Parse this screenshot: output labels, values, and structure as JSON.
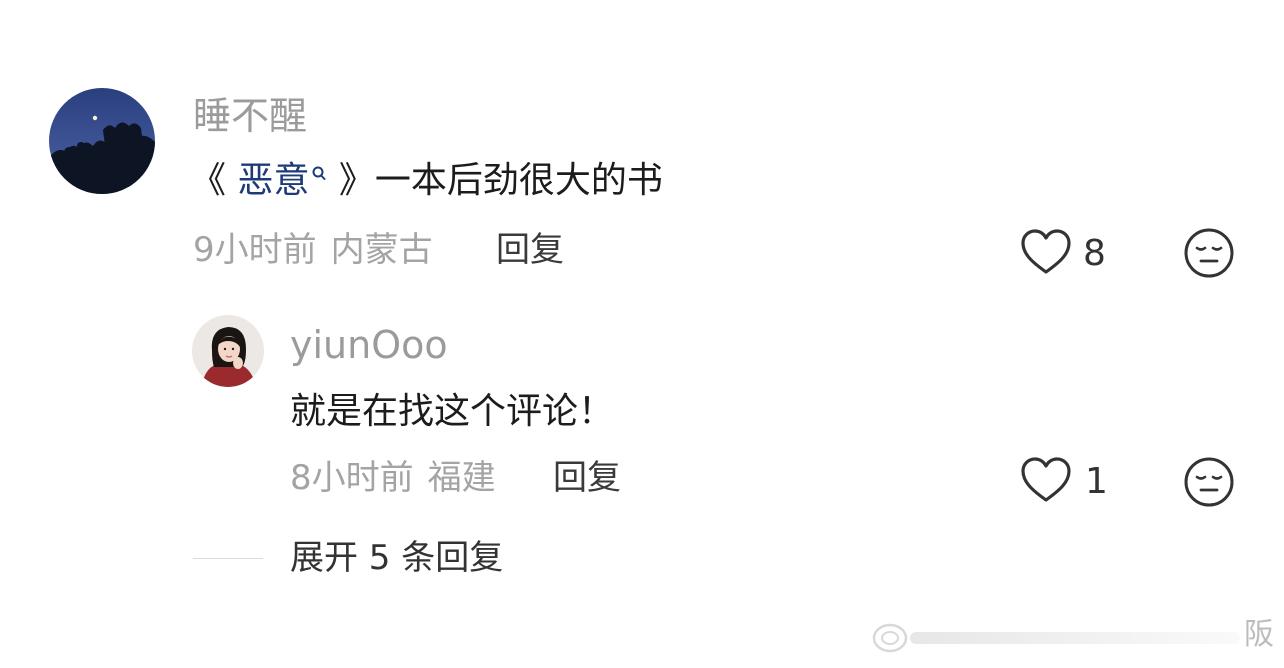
{
  "comment": {
    "username": "睡不醒",
    "text_prefix": "《 ",
    "book_title": "恶意",
    "text_suffix": " 》一本后劲很大的书",
    "time": "9小时前",
    "location": "内蒙古",
    "reply_label": "回复",
    "like_count": "8",
    "avatar_icon": "night-sky-moon-avatar"
  },
  "reply": {
    "username": "yiunOoo",
    "text": "就是在找这个评论！",
    "time": "8小时前",
    "location": "福建",
    "reply_label": "回复",
    "like_count": "1",
    "avatar_icon": "girl-portrait-avatar"
  },
  "expand_replies": "展开 5 条回复",
  "watermark": {
    "text": "阪",
    "icon": "weibo-logo-watermark"
  },
  "colors": {
    "link": "#1f3a78",
    "muted": "#9b9b9b",
    "text": "#1c1c1c"
  }
}
